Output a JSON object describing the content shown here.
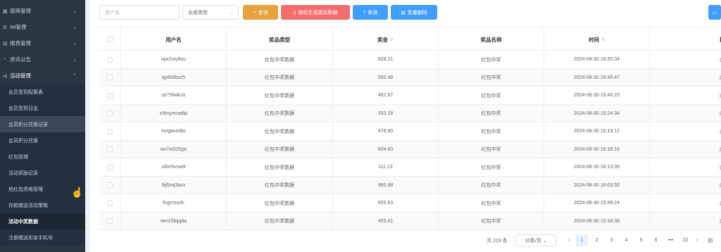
{
  "sidebar": {
    "top_items": [
      {
        "icon": "grid-icon",
        "glyph": "▦",
        "label": "银商管理"
      },
      {
        "icon": "chat-icon",
        "glyph": "⊞",
        "label": "IM管理"
      },
      {
        "icon": "report-icon",
        "glyph": "▤",
        "label": "报表管理"
      },
      {
        "icon": "bell-icon",
        "glyph": "◔",
        "label": "资讯公告"
      },
      {
        "icon": "send-icon",
        "glyph": "◁",
        "label": "活动管理"
      }
    ],
    "sub_items": [
      "会员签到配置表",
      "会员签到日志",
      "会员积分兑换记录",
      "会员积分兑换",
      "红包管理",
      "活动奖励记录",
      "抢红包资格管理",
      "存款赠送活动策略",
      "活动中奖数据",
      "注册赠送彩金手机号"
    ]
  },
  "toolbar": {
    "username_placeholder": "用户名",
    "type_select_value": "全部类型",
    "query_label": "查询",
    "random_label": "随机生成虚拟数据",
    "add_label": "新增",
    "batch_delete_label": "批量删除"
  },
  "table": {
    "columns": [
      "用户名",
      "奖品类型",
      "奖金",
      "奖品名称",
      "时间",
      "操作"
    ],
    "rows": [
      {
        "username": "iqw2uiy8ou",
        "prize_type": "红包中奖数据",
        "amount": "828.21",
        "prize_name": "红包中奖",
        "time": "2024-08-30 16:55:34"
      },
      {
        "username": "igs6i0bsc5",
        "prize_type": "红包中奖数据",
        "amount": "550.49",
        "prize_name": "红包中奖",
        "time": "2024-08-30 16:45:47"
      },
      {
        "username": "ce75fwkciz",
        "prize_type": "红包中奖数据",
        "amount": "462.87",
        "prize_name": "红包中奖",
        "time": "2024-08-30 16:40:23"
      },
      {
        "username": "s9mymcadip",
        "prize_type": "红包中奖数据",
        "amount": "333.28",
        "prize_name": "红包中奖",
        "time": "2024-08-30 16:24:34"
      },
      {
        "username": "inogwuvtbc",
        "prize_type": "红包中奖数据",
        "amount": "478.90",
        "prize_name": "红包中奖",
        "time": "2024-08-30 16:19:12"
      },
      {
        "username": "sw7w325yjn",
        "prize_type": "红包中奖数据",
        "amount": "804.60",
        "prize_name": "红包中奖",
        "time": "2024-08-30 16:18:16"
      },
      {
        "username": "xl6rr9vow9",
        "prize_type": "红包中奖数据",
        "amount": "111.13",
        "prize_name": "红包中奖",
        "time": "2024-08-30 16:13:35"
      },
      {
        "username": "9ij5nq3azx",
        "prize_type": "红包中奖数据",
        "amount": "980.98",
        "prize_name": "红包中奖",
        "time": "2024-08-30 16:03:55"
      },
      {
        "username": "fngrrsuvfc",
        "prize_type": "红包中奖数据",
        "amount": "855.63",
        "prize_name": "红包中奖",
        "time": "2024-08-30 15:49:24"
      },
      {
        "username": "wm23bijq8a",
        "prize_type": "红包中奖数据",
        "amount": "455.41",
        "prize_name": "红包中奖",
        "time": "2024-08-30 15:34:38"
      }
    ]
  },
  "pagination": {
    "total_text": "共 219 条",
    "page_size": "10条/页",
    "pages": [
      "1",
      "2",
      "3",
      "4",
      "5",
      "6",
      "•••",
      "22"
    ],
    "current": "1",
    "prev": "‹",
    "next": "›",
    "goto_label": "前"
  },
  "colors": {
    "sidebar_bg": "#2b3643",
    "primary": "#409eff",
    "warning": "#e6a23c",
    "danger": "#f56c6c"
  }
}
